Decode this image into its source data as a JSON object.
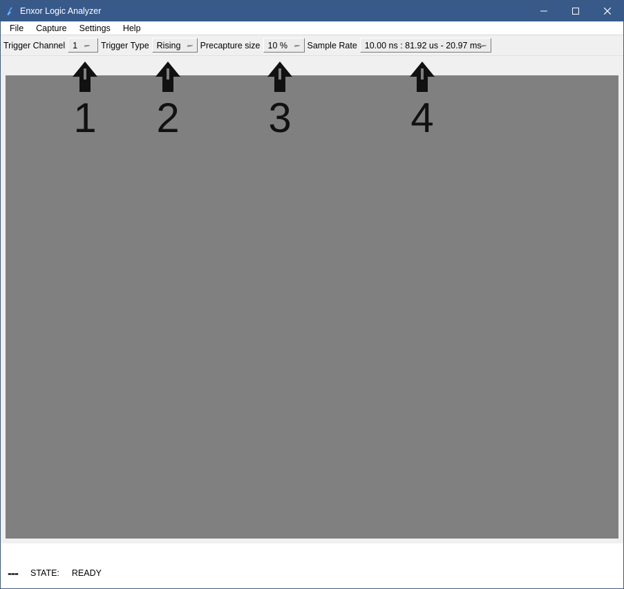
{
  "window": {
    "title": "Enxor Logic Analyzer"
  },
  "menu": {
    "items": [
      "File",
      "Capture",
      "Settings",
      "Help"
    ]
  },
  "toolbar": {
    "trigger_channel_label": "Trigger Channel",
    "trigger_channel_value": "1",
    "trigger_type_label": "Trigger Type",
    "trigger_type_value": "Rising",
    "precapture_label": "Precapture size",
    "precapture_value": "10 %",
    "sample_rate_label": "Sample Rate",
    "sample_rate_value": "10.00 ns : 81.92 us - 20.97 ms"
  },
  "annotations": {
    "a1": "1",
    "a2": "2",
    "a3": "3",
    "a4": "4"
  },
  "status": {
    "indicator": "---",
    "state_label": "STATE:",
    "state_value": "READY"
  },
  "colors": {
    "titlebar": "#385a8a",
    "canvas": "#808080",
    "arrow": "#111111"
  }
}
